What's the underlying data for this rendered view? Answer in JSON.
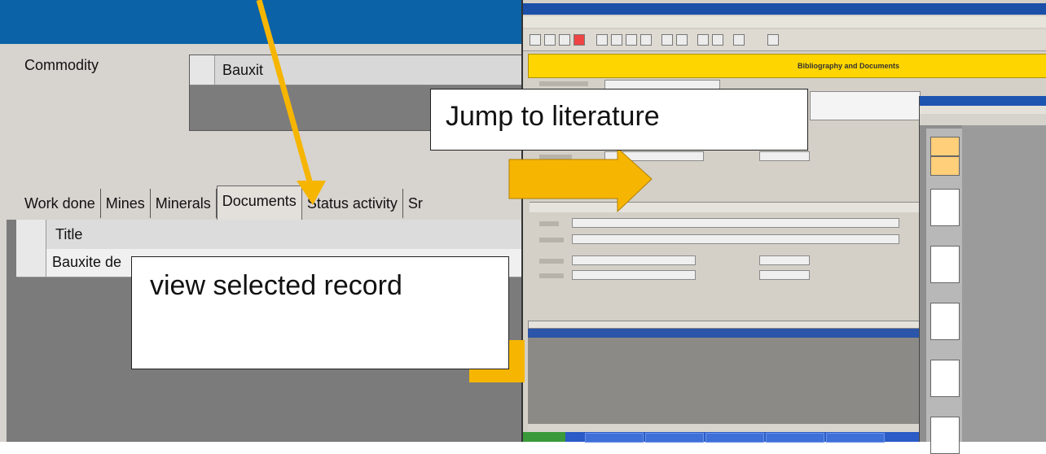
{
  "left_panel": {
    "commodity_label": "Commodity",
    "commodity_value": "Bauxit",
    "tabs": [
      "Work done",
      "Mines",
      "Minerals",
      "Documents",
      "Status activity",
      "Sr"
    ],
    "active_tab_index": 3,
    "grid": {
      "column_title": "Title",
      "rows": [
        "Bauxite de"
      ]
    }
  },
  "callouts": {
    "view_selected": "view selected record",
    "jump_literature": "Jump to literature"
  },
  "app": {
    "header_title": "Bibliography and Documents"
  },
  "colors": {
    "top_band": "#0b62a6",
    "arrow_yellow": "#f6b500",
    "header_yellow": "#ffd500",
    "selection_blue": "#2a55a8"
  }
}
